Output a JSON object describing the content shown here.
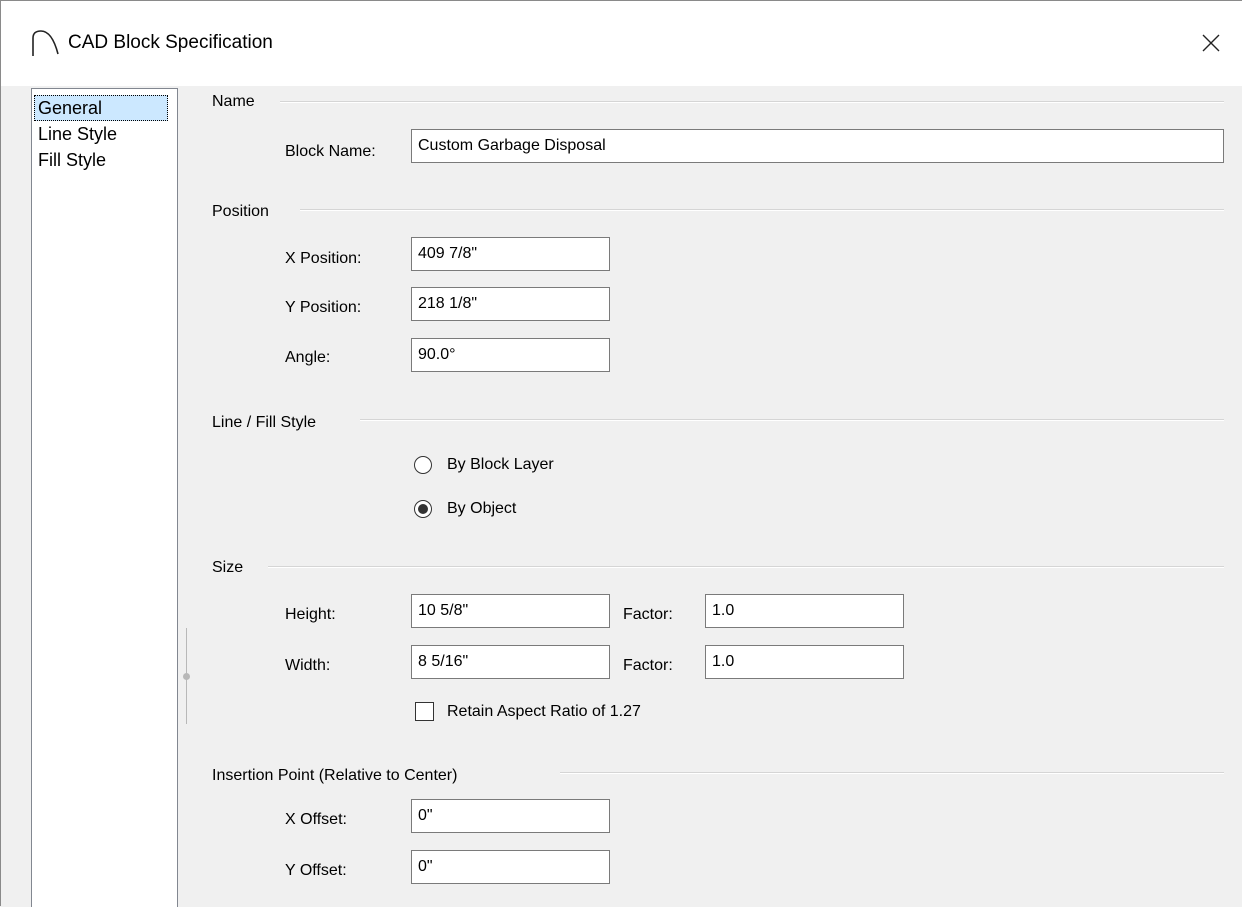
{
  "window": {
    "title": "CAD Block Specification",
    "app_icon": "arc-icon",
    "close_glyph": "✕"
  },
  "nav": {
    "items": [
      {
        "label": "General",
        "selected": true
      },
      {
        "label": "Line Style",
        "selected": false
      },
      {
        "label": "Fill Style",
        "selected": false
      }
    ]
  },
  "name_section": {
    "title": "Name",
    "block_name_label": "Block Name:",
    "block_name_value": "Custom Garbage Disposal"
  },
  "position_section": {
    "title": "Position",
    "x_label": "X Position:",
    "x_value": "409 7/8\"",
    "y_label": "Y Position:",
    "y_value": "218 1/8\"",
    "angle_label": "Angle:",
    "angle_value": "90.0°"
  },
  "line_fill_section": {
    "title": "Line / Fill Style",
    "option_block_layer": "By Block Layer",
    "option_object": "By Object",
    "selected": "By Object"
  },
  "size_section": {
    "title": "Size",
    "height_label": "Height:",
    "height_value": "10 5/8\"",
    "height_factor_label": "Factor:",
    "height_factor_value": "1.0",
    "width_label": "Width:",
    "width_value": "8 5/16\"",
    "width_factor_label": "Factor:",
    "width_factor_value": "1.0",
    "retain_aspect_label": "Retain Aspect Ratio of 1.27",
    "retain_aspect_checked": false
  },
  "insertion_section": {
    "title": "Insertion Point (Relative to Center)",
    "x_offset_label": "X Offset:",
    "x_offset_value": "0\"",
    "y_offset_label": "Y Offset:",
    "y_offset_value": "0\""
  }
}
